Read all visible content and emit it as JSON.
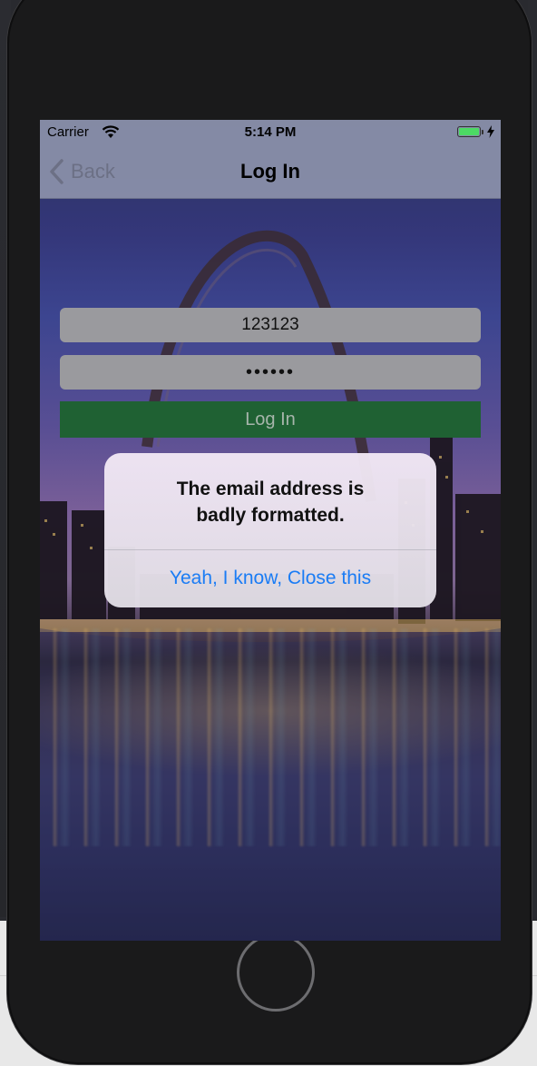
{
  "status_bar": {
    "carrier": "Carrier",
    "time": "5:14 PM",
    "icons": [
      "wifi-icon",
      "battery-icon",
      "charging-bolt-icon"
    ],
    "battery_color": "#4cd964"
  },
  "nav_bar": {
    "back_label": "Back",
    "title": "Log In"
  },
  "form": {
    "email_value": "123123",
    "password_value": "••••••",
    "login_label": "Log In",
    "login_color": "#1f6133"
  },
  "alert": {
    "message_line1": "The email address is",
    "message_line2": "badly formatted.",
    "action_label": "Yeah, I know, Close this",
    "action_color": "#1a7cf5"
  }
}
